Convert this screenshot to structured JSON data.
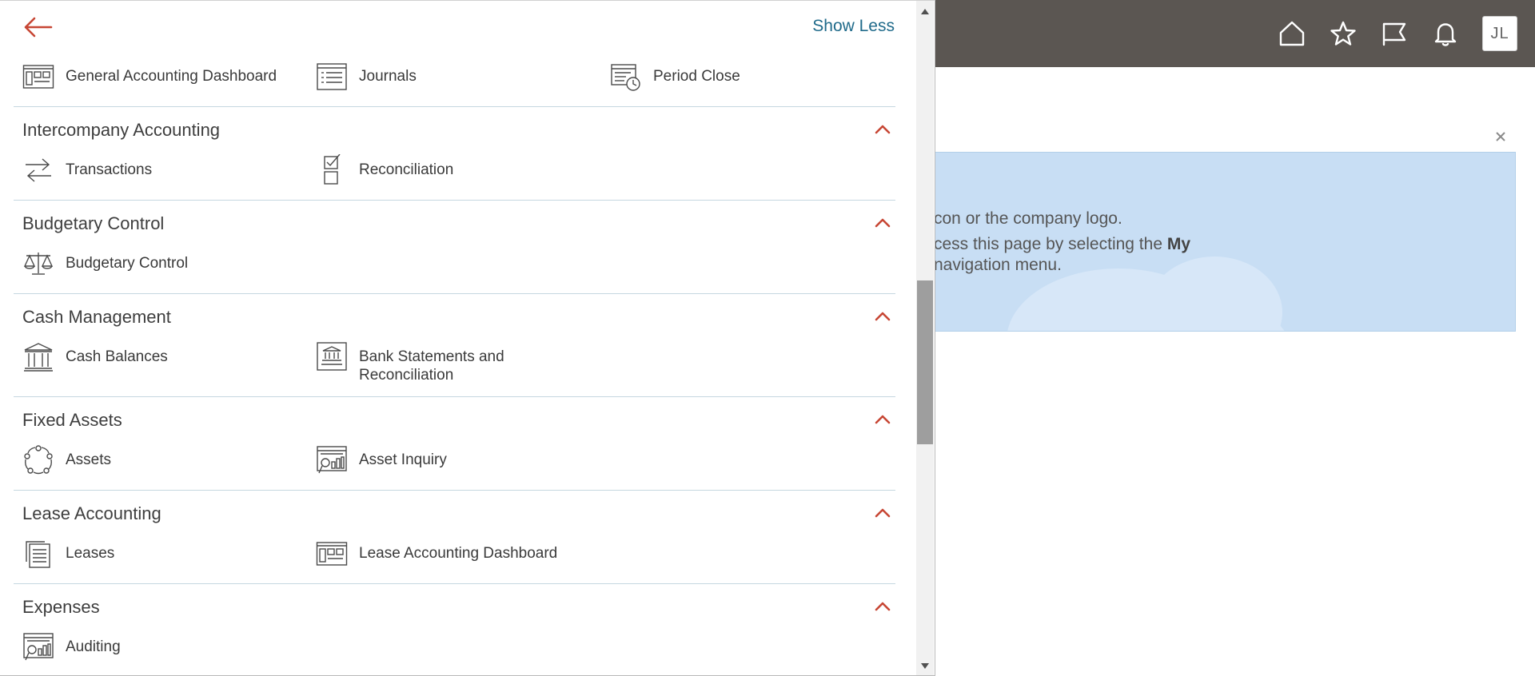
{
  "header": {
    "avatar_initials": "JL",
    "icons": [
      "home-icon",
      "favorites-star-icon",
      "watchlist-flag-icon",
      "notifications-bell-icon"
    ]
  },
  "banner": {
    "line1": "con or the company logo.",
    "line2_prefix": "cess this page by selecting the ",
    "line2_bold": "My",
    "line3": "navigation menu."
  },
  "navigator": {
    "show_less": "Show Less",
    "top_items": [
      {
        "label": "General Accounting Dashboard",
        "icon": "dashboard-icon"
      },
      {
        "label": "Journals",
        "icon": "journal-list-icon"
      },
      {
        "label": "Period Close",
        "icon": "period-close-icon"
      }
    ],
    "sections": [
      {
        "title": "Intercompany Accounting",
        "items": [
          {
            "label": "Transactions",
            "icon": "transfer-arrows-icon"
          },
          {
            "label": "Reconciliation",
            "icon": "checklist-icon"
          }
        ]
      },
      {
        "title": "Budgetary Control",
        "items": [
          {
            "label": "Budgetary Control",
            "icon": "balance-scale-icon"
          }
        ]
      },
      {
        "title": "Cash Management",
        "items": [
          {
            "label": "Cash Balances",
            "icon": "bank-building-icon"
          },
          {
            "label": "Bank Statements and Reconciliation",
            "line1": "Bank Statements and",
            "line2": "Reconciliation",
            "icon": "bank-statement-icon"
          }
        ]
      },
      {
        "title": "Fixed Assets",
        "items": [
          {
            "label": "Assets",
            "icon": "asset-cycle-icon"
          },
          {
            "label": "Asset Inquiry",
            "icon": "asset-inquiry-icon"
          }
        ]
      },
      {
        "title": "Lease Accounting",
        "items": [
          {
            "label": "Leases",
            "icon": "document-stack-icon"
          },
          {
            "label": "Lease Accounting Dashboard",
            "icon": "dashboard-icon"
          }
        ]
      },
      {
        "title": "Expenses",
        "items": [
          {
            "label": "Auditing",
            "icon": "audit-inquiry-icon"
          }
        ]
      }
    ]
  },
  "colors": {
    "topbar": "#5b5652",
    "accent_red": "#c74634",
    "link_blue": "#1f6a8a",
    "banner_blue": "#c8def4"
  }
}
